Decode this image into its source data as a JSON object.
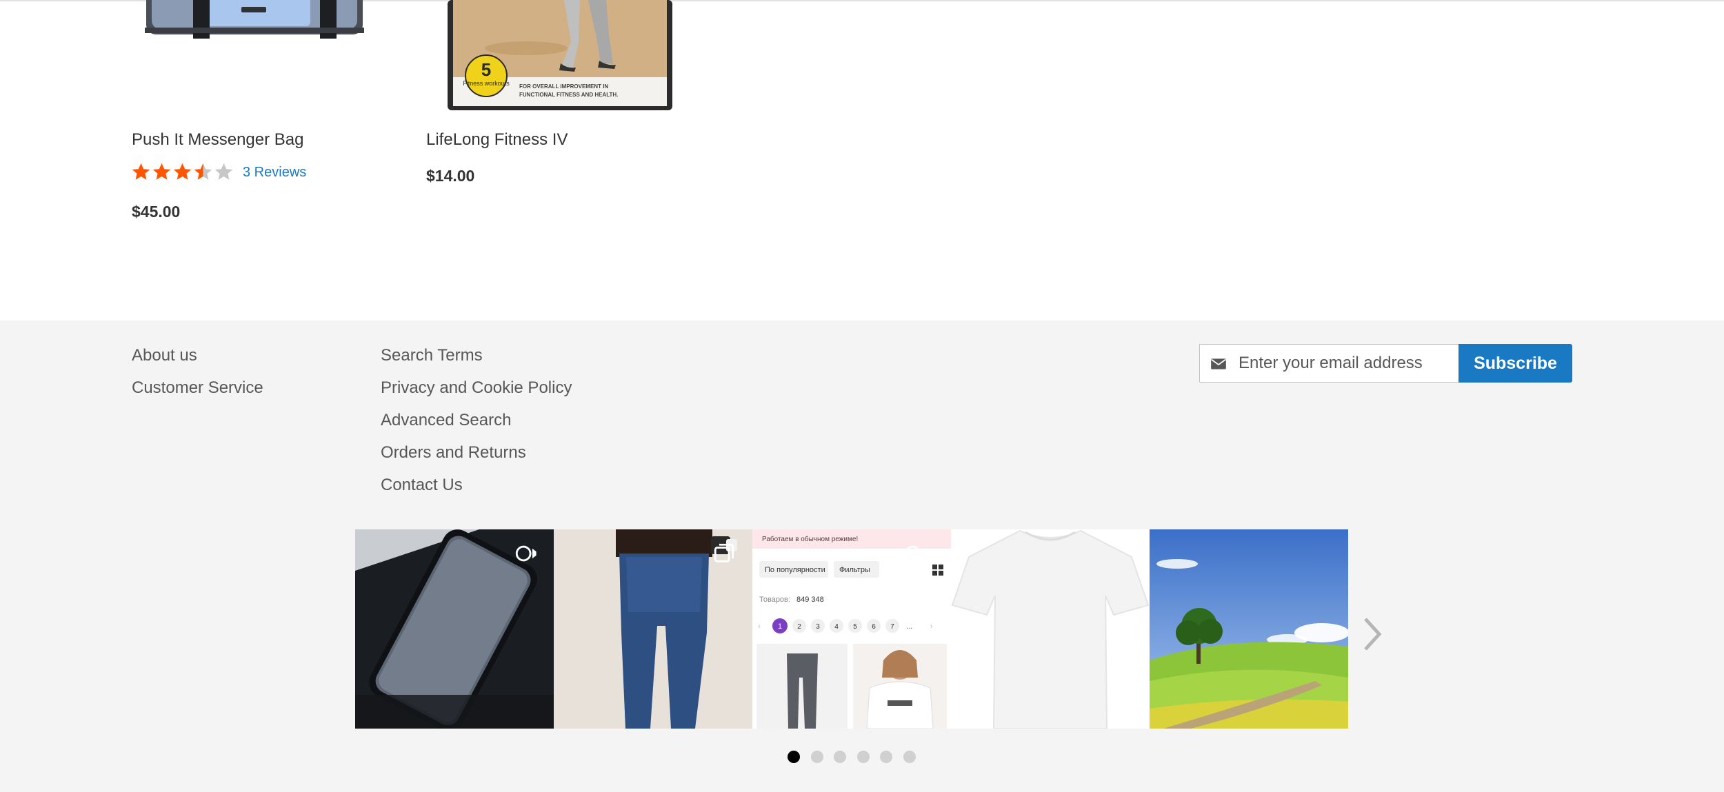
{
  "products": [
    {
      "name": "Push It Messenger Bag",
      "rating_percent": 70,
      "reviews_label": "3 Reviews",
      "price": "$45.00",
      "image_icon": "messenger-bag-image"
    },
    {
      "name": "LifeLong Fitness IV",
      "price": "$14.00",
      "image_icon": "fitness-dvd-image",
      "dvd_badge_number": "5",
      "dvd_badge_text": "Fitness workouts",
      "dvd_caption_line1": "FOR OVERALL IMPROVEMENT IN",
      "dvd_caption_line2": "FUNCTIONAL FITNESS AND HEALTH."
    }
  ],
  "footer": {
    "col1": [
      "About us",
      "Customer Service"
    ],
    "col2": [
      "Search Terms",
      "Privacy and Cookie Policy",
      "Advanced Search",
      "Orders and Returns",
      "Contact Us"
    ],
    "newsletter": {
      "placeholder": "Enter your email address",
      "button_label": "Subscribe",
      "icon": "envelope-icon"
    }
  },
  "instagram_feed": {
    "slides": [
      {
        "subject": "phone-screen-protector-photo"
      },
      {
        "subject": "jeans-photo"
      },
      {
        "subject": "shop-screenshot-photo",
        "banner_text": "Работаем в обычном режиме!",
        "sort_label": "По популярности",
        "filter_label": "Фильтры",
        "count_label": "Товаров:",
        "count_value": "849 348",
        "pages": [
          "1",
          "2",
          "3",
          "4",
          "5",
          "6",
          "7",
          "..."
        ]
      },
      {
        "subject": "white-tshirt-photo"
      },
      {
        "subject": "landscape-tree-photo"
      }
    ],
    "dot_count": 6,
    "active_dot": 0,
    "next_icon": "chevron-right-icon"
  },
  "colors": {
    "star_filled": "#ff5501",
    "star_empty": "#c7c7c7",
    "link": "#1979c3",
    "footer_bg": "#f4f4f4",
    "subscribe_bg": "#1979c3"
  }
}
